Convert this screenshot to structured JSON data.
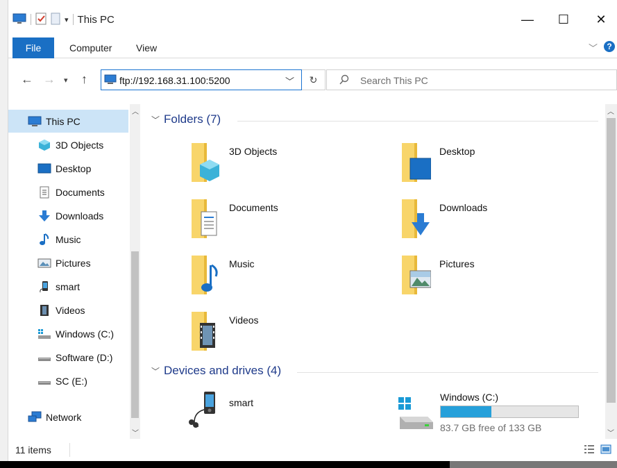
{
  "window": {
    "title": "This PC"
  },
  "titlebar": {
    "minimize": "—",
    "maximize": "☐",
    "close": "✕"
  },
  "ribbon": {
    "tabs": [
      "File",
      "Computer",
      "View"
    ]
  },
  "address": {
    "value": "ftp://192.168.31.100:5200"
  },
  "search": {
    "placeholder": "Search This PC"
  },
  "nav": {
    "items": [
      {
        "label": "This PC",
        "icon": "pc-icon"
      },
      {
        "label": "3D Objects",
        "icon": "3d-objects-icon"
      },
      {
        "label": "Desktop",
        "icon": "desktop-icon"
      },
      {
        "label": "Documents",
        "icon": "documents-icon"
      },
      {
        "label": "Downloads",
        "icon": "downloads-icon"
      },
      {
        "label": "Music",
        "icon": "music-icon"
      },
      {
        "label": "Pictures",
        "icon": "pictures-icon"
      },
      {
        "label": "smart",
        "icon": "phone-icon"
      },
      {
        "label": "Videos",
        "icon": "videos-icon"
      },
      {
        "label": "Windows (C:)",
        "icon": "drive-c-icon"
      },
      {
        "label": "Software (D:)",
        "icon": "drive-icon"
      },
      {
        "label": "SC (E:)",
        "icon": "drive-icon"
      },
      {
        "label": "Network",
        "icon": "network-icon"
      }
    ]
  },
  "groups": {
    "folders_label": "Folders (7)",
    "devices_label": "Devices and drives (4)"
  },
  "folders": [
    {
      "label": "3D Objects"
    },
    {
      "label": "Desktop"
    },
    {
      "label": "Documents"
    },
    {
      "label": "Downloads"
    },
    {
      "label": "Music"
    },
    {
      "label": "Pictures"
    },
    {
      "label": "Videos"
    }
  ],
  "devices": [
    {
      "label": "smart"
    },
    {
      "label": "Windows (C:)",
      "free_text": "83.7 GB free of 133 GB",
      "used_fraction": 0.37
    }
  ],
  "status": {
    "items": "11 items"
  },
  "colors": {
    "accent": "#1a6fc4",
    "selection": "#cce4f7",
    "group_header": "#1e3a8a",
    "drive_bar": "#26a0da"
  }
}
